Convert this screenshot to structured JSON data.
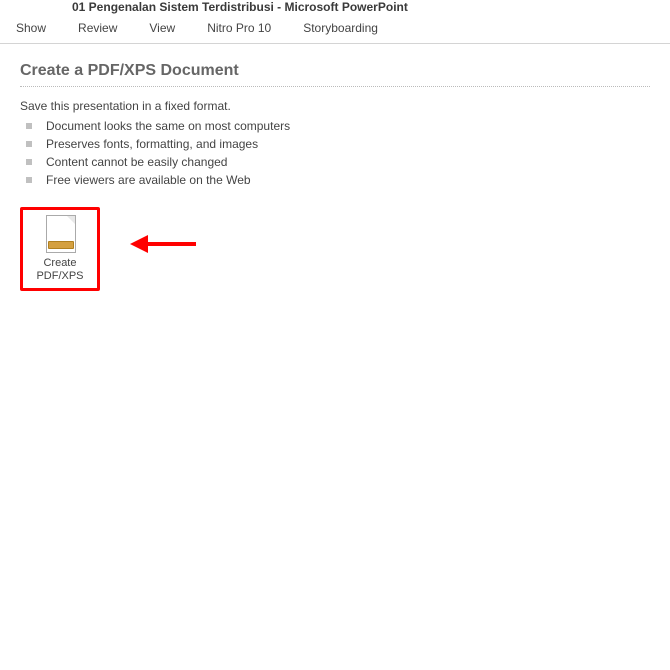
{
  "titleBar": "01 Pengenalan Sistem Terdistribusi  -  Microsoft PowerPoint",
  "ribbon": {
    "tabs": [
      "Show",
      "Review",
      "View",
      "Nitro Pro 10",
      "Storyboarding"
    ]
  },
  "section": {
    "title": "Create a PDF/XPS Document",
    "description": "Save this presentation in a fixed format.",
    "bullets": [
      "Document looks the same on most computers",
      "Preserves fonts, formatting, and images",
      "Content cannot be easily changed",
      "Free viewers are available on the Web"
    ]
  },
  "createButton": {
    "line1": "Create",
    "line2": "PDF/XPS"
  }
}
